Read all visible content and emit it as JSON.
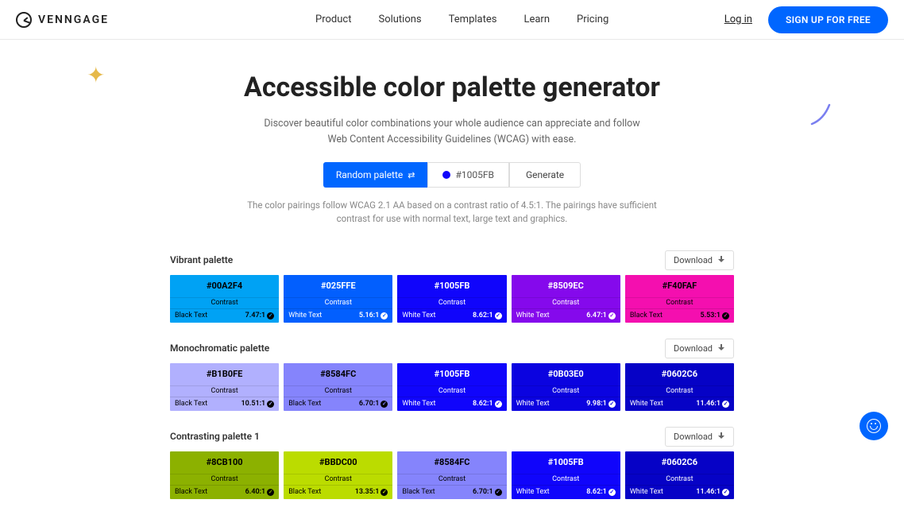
{
  "header": {
    "brand": "VENNGAGE",
    "nav": [
      "Product",
      "Solutions",
      "Templates",
      "Learn",
      "Pricing"
    ],
    "login": "Log in",
    "signup": "SIGN UP FOR FREE"
  },
  "hero": {
    "title": "Accessible color palette generator",
    "subtitle": "Discover beautiful color combinations your whole audience can appreciate and follow Web Content Accessibility Guidelines (WCAG) with ease.",
    "random_btn": "Random palette",
    "color_value": "#1005FB",
    "generate_btn": "Generate",
    "wcag_note": "The color pairings follow WCAG 2.1 AA based on a contrast ratio of 4.5:1. The pairings have sufficient contrast for use with normal text, large text and graphics."
  },
  "labels": {
    "contrast": "Contrast",
    "download": "Download"
  },
  "palettes": [
    {
      "title": "Vibrant palette",
      "swatches": [
        {
          "hex": "#00A2F4",
          "bg": "#00A2F4",
          "text_label": "Black Text",
          "ratio": "7.47:1",
          "fg": "#000"
        },
        {
          "hex": "#025FFE",
          "bg": "#025FFE",
          "text_label": "White Text",
          "ratio": "5.16:1",
          "fg": "#fff"
        },
        {
          "hex": "#1005FB",
          "bg": "#1005FB",
          "text_label": "White Text",
          "ratio": "8.62:1",
          "fg": "#fff"
        },
        {
          "hex": "#8509EC",
          "bg": "#8509EC",
          "text_label": "White Text",
          "ratio": "6.47:1",
          "fg": "#fff"
        },
        {
          "hex": "#F40FAF",
          "bg": "#F40FAF",
          "text_label": "Black Text",
          "ratio": "5.53:1",
          "fg": "#000"
        }
      ]
    },
    {
      "title": "Monochromatic palette",
      "swatches": [
        {
          "hex": "#B1B0FE",
          "bg": "#B1B0FE",
          "text_label": "Black Text",
          "ratio": "10.51:1",
          "fg": "#000"
        },
        {
          "hex": "#8584FC",
          "bg": "#8584FC",
          "text_label": "Black Text",
          "ratio": "6.70:1",
          "fg": "#000"
        },
        {
          "hex": "#1005FB",
          "bg": "#1005FB",
          "text_label": "White Text",
          "ratio": "8.62:1",
          "fg": "#fff"
        },
        {
          "hex": "#0B03E0",
          "bg": "#0B03E0",
          "text_label": "White Text",
          "ratio": "9.98:1",
          "fg": "#fff"
        },
        {
          "hex": "#0602C6",
          "bg": "#0602C6",
          "text_label": "White Text",
          "ratio": "11.46:1",
          "fg": "#fff"
        }
      ]
    },
    {
      "title": "Contrasting palette 1",
      "swatches": [
        {
          "hex": "#8CB100",
          "bg": "#8CB100",
          "text_label": "Black Text",
          "ratio": "6.40:1",
          "fg": "#000"
        },
        {
          "hex": "#BBDC00",
          "bg": "#BBDC00",
          "text_label": "Black Text",
          "ratio": "13.35:1",
          "fg": "#000"
        },
        {
          "hex": "#8584FC",
          "bg": "#8584FC",
          "text_label": "Black Text",
          "ratio": "6.70:1",
          "fg": "#000"
        },
        {
          "hex": "#1005FB",
          "bg": "#1005FB",
          "text_label": "White Text",
          "ratio": "8.62:1",
          "fg": "#fff"
        },
        {
          "hex": "#0602C6",
          "bg": "#0602C6",
          "text_label": "White Text",
          "ratio": "11.46:1",
          "fg": "#fff"
        }
      ]
    }
  ]
}
